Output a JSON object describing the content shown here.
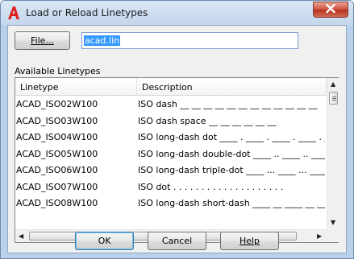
{
  "window": {
    "title": "Load or Reload Linetypes",
    "app_icon": "autocad-a-icon",
    "close_icon": "close-x-icon"
  },
  "file": {
    "button_label": "File...",
    "value": "acad.lin"
  },
  "linetypes": {
    "group_label": "Available Linetypes",
    "columns": [
      "Linetype",
      "Description"
    ],
    "rows": [
      {
        "name": "ACAD_ISO02W100",
        "description": "ISO dash __ __ __ __ __ __ __ __ __ __ __ __"
      },
      {
        "name": "ACAD_ISO03W100",
        "description": "ISO dash space __    __    __    __    __    __"
      },
      {
        "name": "ACAD_ISO04W100",
        "description": "ISO long-dash dot ____ . ____ . ____ . ____ . _"
      },
      {
        "name": "ACAD_ISO05W100",
        "description": "ISO long-dash double-dot ____ .. ____ .. ____ ."
      },
      {
        "name": "ACAD_ISO06W100",
        "description": "ISO long-dash triple-dot ____ ... ____ ... ____"
      },
      {
        "name": "ACAD_ISO07W100",
        "description": "ISO dot . . . . . . . . . . . . . . . . . . . ."
      },
      {
        "name": "ACAD_ISO08W100",
        "description": "ISO long-dash short-dash ____ __ ____ __ ____ _"
      }
    ]
  },
  "buttons": {
    "ok": "OK",
    "cancel": "Cancel",
    "help": "Help"
  },
  "colors": {
    "frame": "#b9d1ea",
    "close_button": "#cf4d3a",
    "selection": "#3399ff",
    "default_button_border": "#3c7fb1"
  }
}
